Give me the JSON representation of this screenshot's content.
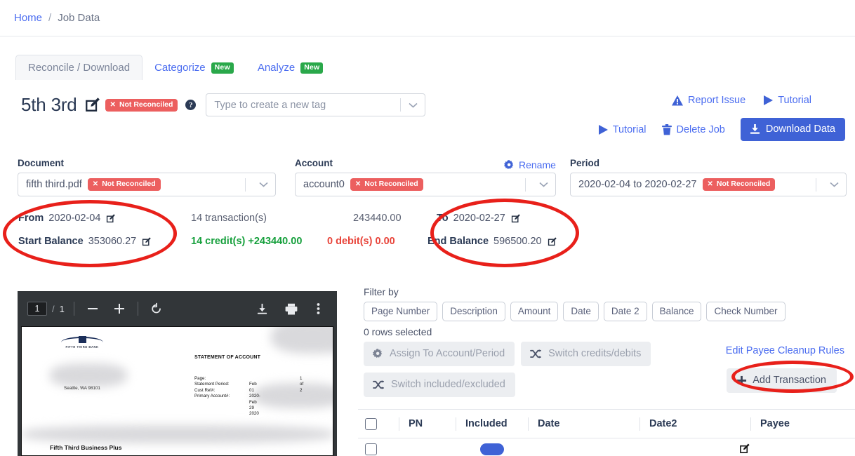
{
  "breadcrumb": {
    "home": "Home",
    "separator": "/",
    "current": "Job Data"
  },
  "tabs": [
    {
      "label": "Reconcile / Download",
      "badge": "",
      "active": true
    },
    {
      "label": "Categorize",
      "badge": "New",
      "active": false
    },
    {
      "label": "Analyze",
      "badge": "New",
      "active": false
    }
  ],
  "header": {
    "job_title": "5th 3rd",
    "status_badge": "Not Reconciled",
    "status_badge_x": "✕",
    "help": "?",
    "tag_placeholder": "Type to create a new tag"
  },
  "actions": {
    "report_issue": "Report Issue",
    "tutorial_top": "Tutorial",
    "tutorial_bottom": "Tutorial",
    "delete_job": "Delete Job",
    "download_data": "Download Data"
  },
  "selectors": {
    "document_label": "Document",
    "document_value": "fifth third.pdf",
    "document_badge": "Not Reconciled",
    "account_label": "Account",
    "account_value": "account0",
    "account_badge": "Not Reconciled",
    "rename": "Rename",
    "period_label": "Period",
    "period_value": "2020-02-04 to 2020-02-27",
    "period_badge": "Not Reconciled"
  },
  "summary": {
    "from_label": "From",
    "from_value": "2020-02-04",
    "start_balance_label": "Start Balance",
    "start_balance_value": "353060.27",
    "transactions": "14 transaction(s)",
    "credits": "14 credit(s) +243440.00",
    "total_amount": "243440.00",
    "debits": "0 debit(s) 0.00",
    "to_label": "To",
    "to_value": "2020-02-27",
    "end_balance_label": "End Balance",
    "end_balance_value": "596500.20"
  },
  "pdf": {
    "page_current": "1",
    "page_slash": "/",
    "page_total": "1",
    "bank_name": "FIFTH THIRD BANK",
    "address": "Seattle, WA 98101",
    "statement_title": "STATEMENT OF ACCOUNT",
    "meta": [
      {
        "label": "Page:",
        "value": "1 of 2"
      },
      {
        "label": "Statement Period:",
        "value": "Feb 01 2020- Feb 29 2020"
      },
      {
        "label": "Cust Ref#:",
        "value": ""
      },
      {
        "label": "Primary Account#:",
        "value": ""
      }
    ],
    "footer": "Fifth Third Business Plus"
  },
  "filters": {
    "label": "Filter by",
    "chips": [
      "Page Number",
      "Description",
      "Amount",
      "Date",
      "Date 2",
      "Balance",
      "Check Number"
    ],
    "rows_selected": "0 rows selected"
  },
  "bulk_actions": {
    "assign": "Assign To Account/Period",
    "switch_credits": "Switch credits/debits",
    "switch_included": "Switch included/excluded",
    "edit_payee_rules": "Edit Payee Cleanup Rules",
    "add_transaction": "Add Transaction"
  },
  "table": {
    "columns": [
      "PN",
      "Included",
      "Date",
      "Date2",
      "Payee"
    ]
  },
  "colors": {
    "accent_blue": "#4a6cf0",
    "primary_blue": "#3f62d6",
    "danger_red": "#ec5f5f",
    "success_green": "#2aa84a",
    "credit_green": "#17a03d",
    "debit_red": "#e8443a",
    "annotation_red": "#e8201a"
  }
}
